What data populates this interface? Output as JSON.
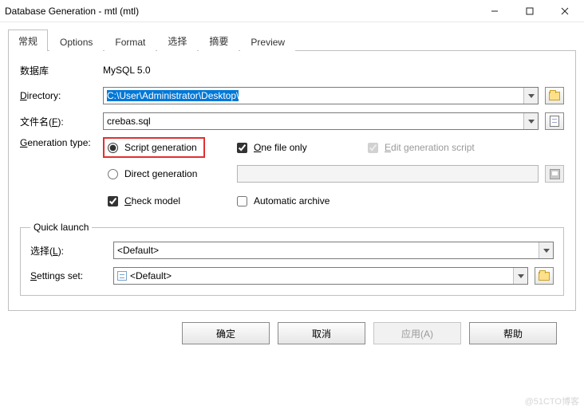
{
  "window": {
    "title": "Database Generation - mtl (mtl)"
  },
  "tabs": [
    "常规",
    "Options",
    "Format",
    "选择",
    "摘要",
    "Preview"
  ],
  "active_tab": 0,
  "form": {
    "database_label": "数据库",
    "database_value": "MySQL 5.0",
    "directory_label_pre": "D",
    "directory_label_post": "irectory:",
    "directory_value": "C:\\User\\Administrator\\Desktop\\",
    "filename_label": "文件名(F):",
    "filename_mnemonic": "F",
    "filename_value": "crebas.sql",
    "gentype_label_pre": "G",
    "gentype_label_post": "eneration type:",
    "radio_script": "Script generation",
    "radio_direct": "Direct generation",
    "check_onefile_pre": "O",
    "check_onefile_post": "ne file only",
    "check_editscript_pre": "E",
    "check_editscript_post": "dit generation script",
    "check_checkmodel_pre": "C",
    "check_checkmodel_post": "heck model",
    "check_autoarchive": "Automatic archive"
  },
  "quicklaunch": {
    "legend": "Quick launch",
    "select_label": "选择(L):",
    "select_value": "<Default>",
    "settings_label_pre": "S",
    "settings_label_post": "ettings set:",
    "settings_value": "<Default>"
  },
  "buttons": {
    "ok": "确定",
    "cancel": "取消",
    "apply": "应用(A)",
    "help": "帮助"
  },
  "watermark": "@51CTO博客"
}
